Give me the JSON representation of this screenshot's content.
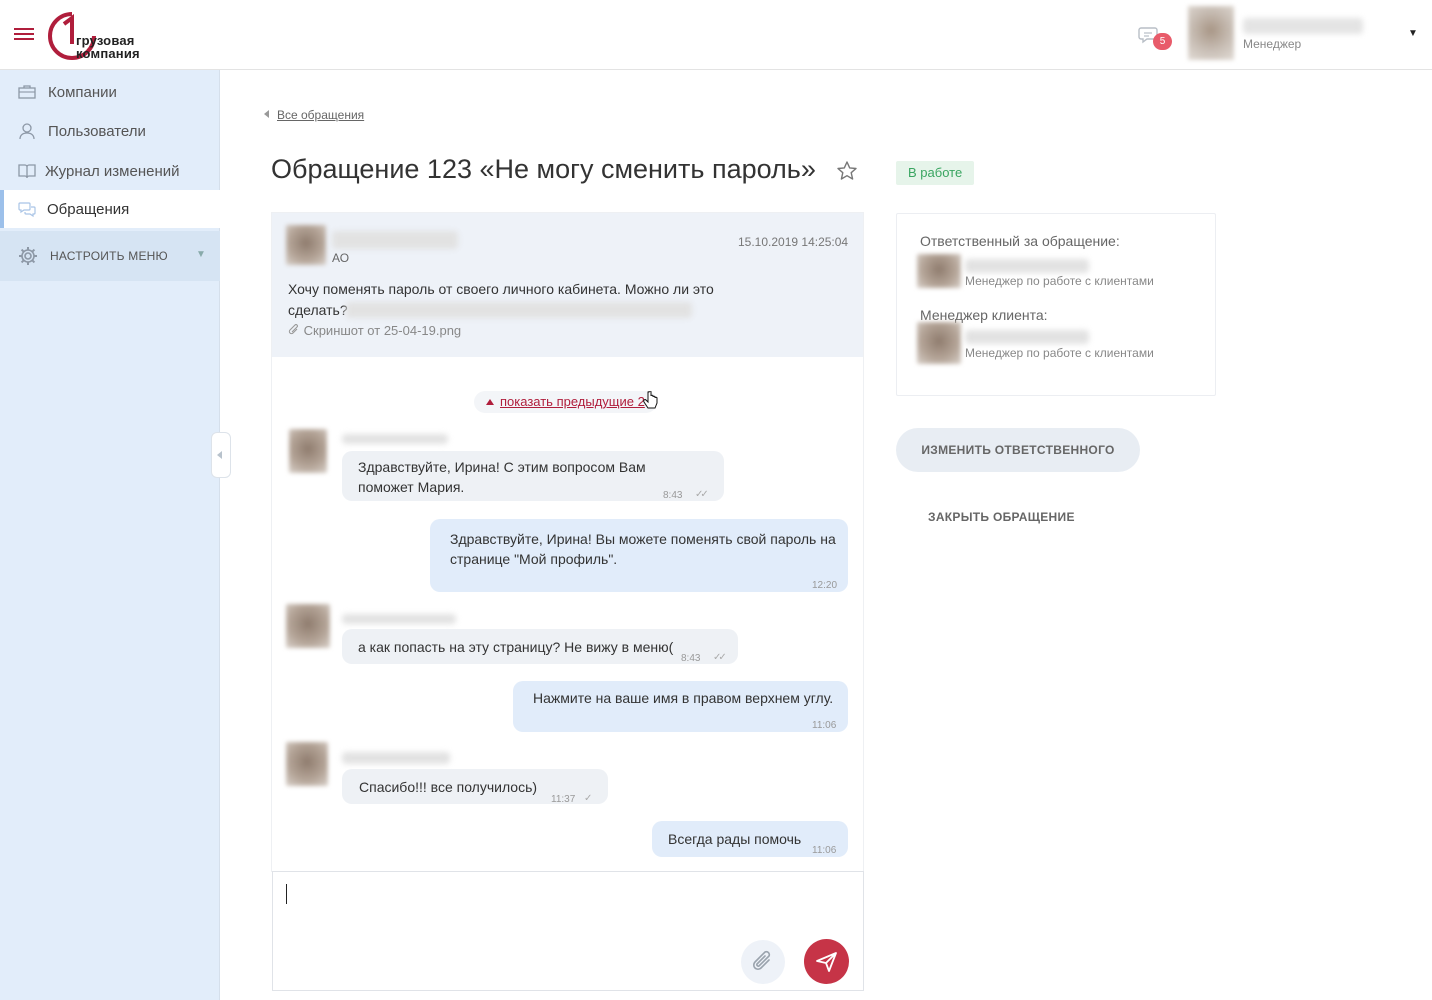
{
  "header": {
    "logo_text_line1": "грузовая",
    "logo_text_line2": "компания",
    "notifications_count": "5",
    "user_role": "Менеджер"
  },
  "sidebar": {
    "items": [
      {
        "label": "Компании",
        "icon": "briefcase-icon"
      },
      {
        "label": "Пользователи",
        "icon": "user-icon"
      },
      {
        "label": "Журнал изменений",
        "icon": "book-icon"
      },
      {
        "label": "Обращения",
        "icon": "chat-bubbles-icon",
        "active": true
      }
    ],
    "settings_label": "НАСТРОИТЬ МЕНЮ"
  },
  "breadcrumb": {
    "back_label": "Все обращения"
  },
  "ticket": {
    "title": "Обращение 123 «Не могу сменить пароль»",
    "status": "В работе",
    "status_color": "#3aa561"
  },
  "origin_message": {
    "company_prefix": "АО",
    "datetime": "15.10.2019  14:25:04",
    "text": "Хочу поменять пароль от своего личного кабинета. Можно ли это сделать?",
    "attachment": "Скриншот от 25-04-19.png"
  },
  "chat": {
    "show_previous_label": "показать предыдущие 2",
    "messages": [
      {
        "direction": "in",
        "text": "Здравствуйте, Ирина! С этим вопросом Вам поможет Мария.",
        "time": "8:43",
        "read": true
      },
      {
        "direction": "out",
        "text": "Здравствуйте, Ирина! Вы можете поменять свой пароль на странице \"Мой профиль\".",
        "time": "12:20"
      },
      {
        "direction": "in",
        "text": "а как попасть на эту страницу? Не вижу в меню(",
        "time": "8:43",
        "read": true
      },
      {
        "direction": "out",
        "text": "Нажмите на ваше имя в правом верхнем углу.",
        "time": "11:06"
      },
      {
        "direction": "in",
        "text": "Спасибо!!! все получилось)",
        "time": "11:37",
        "read": false
      },
      {
        "direction": "out",
        "text": "Всегда рады помочь",
        "time": "11:06"
      }
    ]
  },
  "composer": {
    "value": ""
  },
  "details": {
    "responsible_label": "Ответственный за обращение:",
    "responsible_role": "Менеджер по работе с клиентами",
    "manager_label": "Менеджер клиента:",
    "manager_role": "Менеджер по работе с клиентами"
  },
  "actions": {
    "change_responsible": "ИЗМЕНИТЬ ОТВЕТСТВЕННОГО",
    "close_ticket": "ЗАКРЫТЬ ОБРАЩЕНИЕ"
  },
  "colors": {
    "brand": "#b01e3c",
    "sidebar_bg": "#e2edfa",
    "outgoing_bubble": "#e1ecfa",
    "incoming_bubble": "#eef1f5",
    "send_button": "#c63447"
  }
}
